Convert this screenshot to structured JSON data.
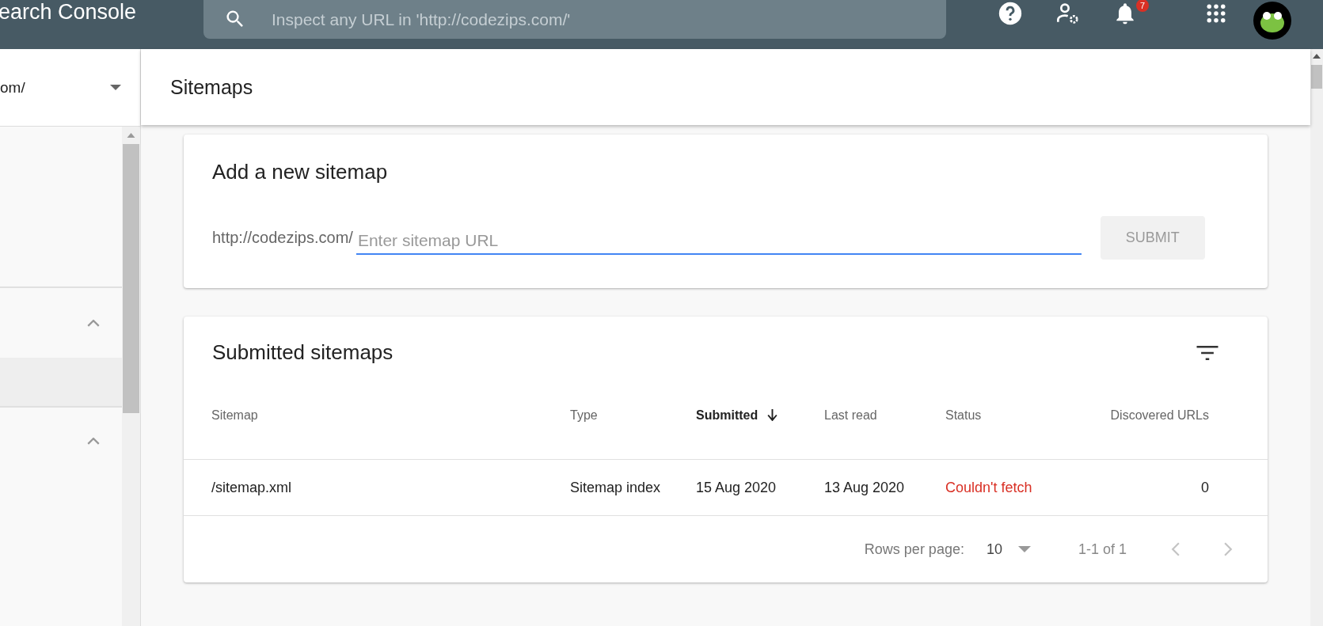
{
  "app": {
    "title": "earch Console",
    "search": {
      "placeholder": "Inspect any URL in 'http://codezips.com/'"
    },
    "notifications": {
      "count": "7"
    }
  },
  "sidebar": {
    "property": "om/",
    "sections": [
      {
        "expanded": true,
        "items": [
          {
            "selected": true
          }
        ]
      },
      {
        "expanded": true
      }
    ]
  },
  "page": {
    "title": "Sitemaps"
  },
  "add_sitemap": {
    "title": "Add a new sitemap",
    "prefix": "http://codezips.com/",
    "placeholder": "Enter sitemap URL",
    "submit": {
      "label": "SUBMIT",
      "disabled": true
    }
  },
  "submitted": {
    "title": "Submitted sitemaps",
    "columns": [
      {
        "label": "Sitemap",
        "sorted": false
      },
      {
        "label": "Type",
        "sorted": false
      },
      {
        "label": "Submitted",
        "sorted": true
      },
      {
        "label": "Last read",
        "sorted": false
      },
      {
        "label": "Status",
        "sorted": false
      },
      {
        "label": "Discovered URLs",
        "sorted": false
      }
    ],
    "rows": [
      {
        "sitemap": "/sitemap.xml",
        "type": "Sitemap index",
        "submitted": "15 Aug 2020",
        "last_read": "13 Aug 2020",
        "status": {
          "text": "Couldn't fetch",
          "kind": "error"
        },
        "discovered": "0"
      }
    ],
    "pagination": {
      "rows_label": "Rows per page:",
      "rows_per_page": "10",
      "range": "1-1 of 1",
      "prev_disabled": true,
      "next_disabled": true
    }
  }
}
